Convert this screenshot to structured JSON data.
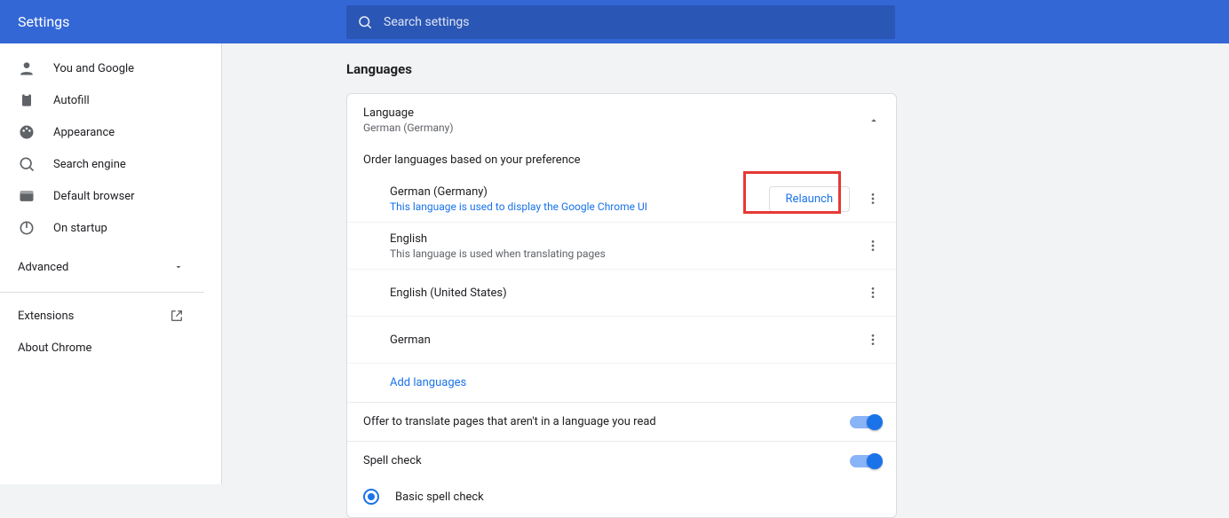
{
  "header": {
    "title": "Settings",
    "search_placeholder": "Search settings"
  },
  "sidebar": {
    "items": [
      {
        "icon": "person",
        "label": "You and Google"
      },
      {
        "icon": "autofill",
        "label": "Autofill"
      },
      {
        "icon": "palette",
        "label": "Appearance"
      },
      {
        "icon": "search",
        "label": "Search engine"
      },
      {
        "icon": "browser",
        "label": "Default browser"
      },
      {
        "icon": "power",
        "label": "On startup"
      }
    ],
    "advanced_label": "Advanced",
    "extensions_label": "Extensions",
    "about_label": "About Chrome"
  },
  "main": {
    "page_title": "Languages",
    "language_section": {
      "title": "Language",
      "current": "German (Germany)"
    },
    "order_hint": "Order languages based on your preference",
    "languages": [
      {
        "name": "German (Germany)",
        "desc": "This language is used to display the Google Chrome UI",
        "relaunch": true
      },
      {
        "name": "English",
        "desc": "This language is used when translating pages"
      },
      {
        "name": "English (United States)"
      },
      {
        "name": "German"
      }
    ],
    "relaunch_label": "Relaunch",
    "add_languages_label": "Add languages",
    "translate_offer": "Offer to translate pages that aren't in a language you read",
    "spell_check_label": "Spell check",
    "basic_spell_check_label": "Basic spell check"
  }
}
